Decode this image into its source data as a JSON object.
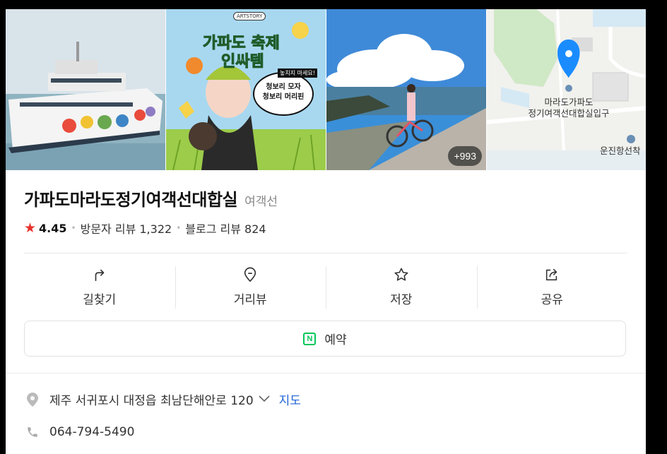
{
  "photos": {
    "more_count": "+993",
    "promo": {
      "badge": "ARTSTORY",
      "headline_1": "가파도 축제",
      "headline_2": "인싸템",
      "tag": "놓치지 마세요!",
      "bubble_1": "청보리 모자",
      "bubble_2": "청보리 머리핀"
    },
    "map": {
      "pin_label_1": "마라도가파도",
      "pin_label_2": "정기여객선대합실입구",
      "poi_label": "운진항선착"
    }
  },
  "place": {
    "name": "가파도마라도정기여객선대합실",
    "category": "여객선",
    "rating": "4.45",
    "visitor_reviews": "방문자 리뷰 1,322",
    "blog_reviews": "블로그 리뷰 824"
  },
  "actions": [
    {
      "label": "길찾기",
      "icon": "directions-icon"
    },
    {
      "label": "거리뷰",
      "icon": "street-view-icon"
    },
    {
      "label": "저장",
      "icon": "star-outline-icon"
    },
    {
      "label": "공유",
      "icon": "share-icon"
    }
  ],
  "reserve": {
    "label": "예약",
    "icon_letter": "N"
  },
  "info": {
    "address": "제주 서귀포시 대정읍 최남단해안로 120",
    "map_link": "지도",
    "phone": "064-794-5490"
  },
  "colors": {
    "accent_red": "#e8312b",
    "link_blue": "#2163d5",
    "naver_green": "#03c75a",
    "map_pin": "#1a8cff"
  }
}
